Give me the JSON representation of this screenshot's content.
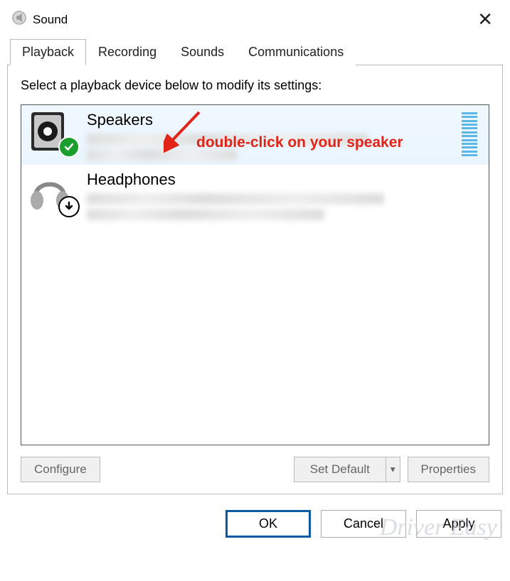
{
  "window": {
    "title": "Sound"
  },
  "tabs": [
    {
      "label": "Playback",
      "active": true
    },
    {
      "label": "Recording",
      "active": false
    },
    {
      "label": "Sounds",
      "active": false
    },
    {
      "label": "Communications",
      "active": false
    }
  ],
  "instruction": "Select a playback device below to modify its settings:",
  "devices": [
    {
      "name": "Speakers",
      "status_badge": "default-check",
      "selected": true,
      "has_vu": true
    },
    {
      "name": "Headphones",
      "status_badge": "download-arrow",
      "selected": false,
      "has_vu": false
    }
  ],
  "buttons": {
    "configure": "Configure",
    "set_default": "Set Default",
    "properties": "Properties",
    "ok": "OK",
    "cancel": "Cancel",
    "apply": "Apply"
  },
  "annotation": {
    "text": "double-click on your speaker"
  },
  "watermark": "Driver Easy"
}
